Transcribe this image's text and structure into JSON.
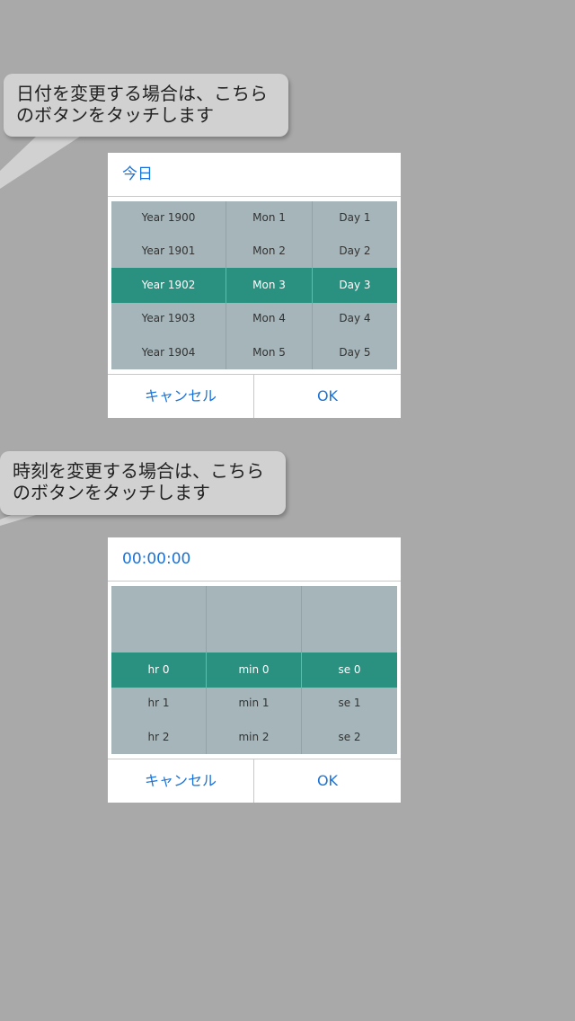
{
  "colors": {
    "background": "#a9a9a9",
    "accent": "#1a73d9",
    "selection": "#2a9080",
    "picker_bg": "#a6b5b9",
    "bubble": "#d1d1d1"
  },
  "date_hint": {
    "line1": "日付を変更する場合は、こちら",
    "line2": "のボタンをタッチします"
  },
  "date_dialog": {
    "header": "今日",
    "columns": [
      {
        "items": [
          "Year 1900",
          "Year 1901",
          "Year 1902",
          "Year 1903",
          "Year 1904"
        ],
        "selected": 2
      },
      {
        "items": [
          "Mon 1",
          "Mon 2",
          "Mon 3",
          "Mon 4",
          "Mon 5"
        ],
        "selected": 2
      },
      {
        "items": [
          "Day 1",
          "Day 2",
          "Day 3",
          "Day 4",
          "Day 5"
        ],
        "selected": 2
      }
    ],
    "cancel_label": "キャンセル",
    "ok_label": "OK"
  },
  "time_hint": {
    "line1": "時刻を変更する場合は、こちら",
    "line2": "のボタンをタッチします"
  },
  "time_dialog": {
    "header": "00:00:00",
    "columns": [
      {
        "items": [
          "",
          "",
          "hr 0",
          "hr 1",
          "hr 2"
        ],
        "selected": 2
      },
      {
        "items": [
          "",
          "",
          "min 0",
          "min 1",
          "min 2"
        ],
        "selected": 2
      },
      {
        "items": [
          "",
          "",
          "se 0",
          "se 1",
          "se 2"
        ],
        "selected": 2
      }
    ],
    "cancel_label": "キャンセル",
    "ok_label": "OK"
  }
}
